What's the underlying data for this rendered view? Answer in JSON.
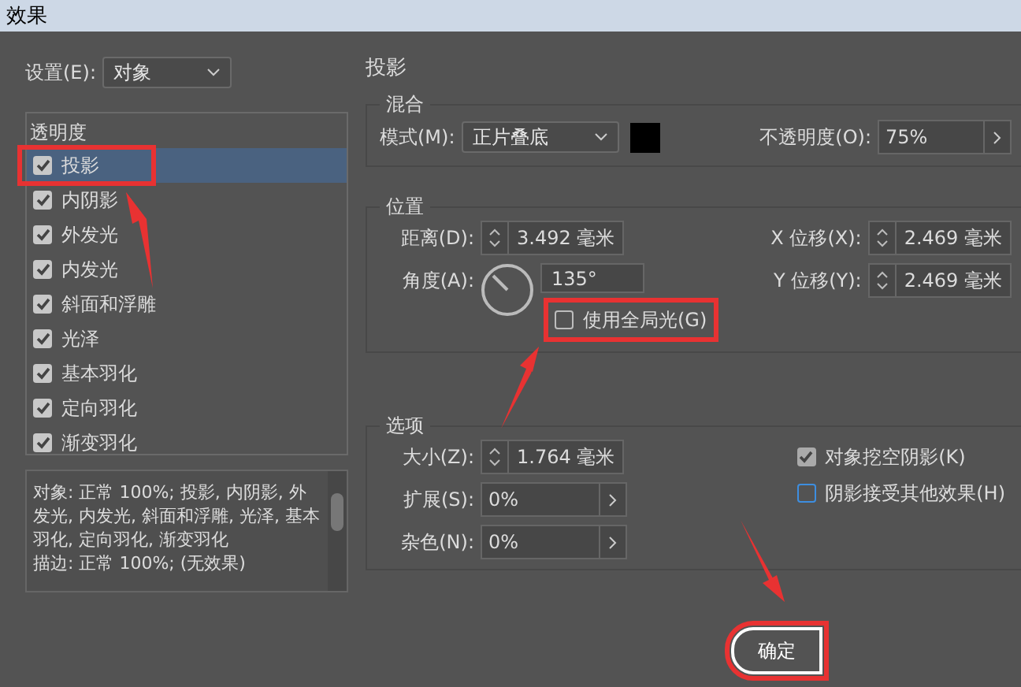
{
  "window": {
    "title": "效果"
  },
  "settings": {
    "label": "设置(E):",
    "value": "对象"
  },
  "effects_list": {
    "header": "透明度",
    "items": [
      {
        "label": "投影",
        "checked": true,
        "selected": true,
        "highlighted": true
      },
      {
        "label": "内阴影",
        "checked": true,
        "selected": false,
        "highlighted": false
      },
      {
        "label": "外发光",
        "checked": true,
        "selected": false,
        "highlighted": false
      },
      {
        "label": "内发光",
        "checked": true,
        "selected": false,
        "highlighted": false
      },
      {
        "label": "斜面和浮雕",
        "checked": true,
        "selected": false,
        "highlighted": false
      },
      {
        "label": "光泽",
        "checked": true,
        "selected": false,
        "highlighted": false
      },
      {
        "label": "基本羽化",
        "checked": true,
        "selected": false,
        "highlighted": false
      },
      {
        "label": "定向羽化",
        "checked": true,
        "selected": false,
        "highlighted": false
      },
      {
        "label": "渐变羽化",
        "checked": true,
        "selected": false,
        "highlighted": false
      }
    ]
  },
  "summary": [
    "对象: 正常 100%; 投影, 内阴影, 外发光, 内发光, 斜面和浮雕, 光泽, 基本羽化, 定向羽化, 渐变羽化",
    "描边: 正常 100%; (无效果)"
  ],
  "panel_title": "投影",
  "blend": {
    "legend": "混合",
    "mode_label": "模式(M):",
    "mode": "正片叠底",
    "color": "#000000",
    "opacity_label": "不透明度(O):",
    "opacity": "75%"
  },
  "position": {
    "legend": "位置",
    "distance_label": "距离(D):",
    "distance": "3.492 毫米",
    "angle_label": "角度(A):",
    "angle": "135°",
    "global_light": {
      "label": "使用全局光(G)",
      "checked": false,
      "highlighted": true
    },
    "x_label": "X 位移(X):",
    "x": "2.469 毫米",
    "y_label": "Y 位移(Y):",
    "y": "2.469 毫米"
  },
  "options": {
    "legend": "选项",
    "size_label": "大小(Z):",
    "size": "1.764 毫米",
    "spread_label": "扩展(S):",
    "spread": "0%",
    "noise_label": "杂色(N):",
    "noise": "0%",
    "checkboxes": [
      {
        "label": "对象挖空阴影(K)",
        "checked": true,
        "disabled": true
      },
      {
        "label": "阴影接受其他效果(H)",
        "checked": false,
        "disabled": false
      }
    ]
  },
  "ok_button": {
    "label": "确定",
    "highlighted": true
  }
}
